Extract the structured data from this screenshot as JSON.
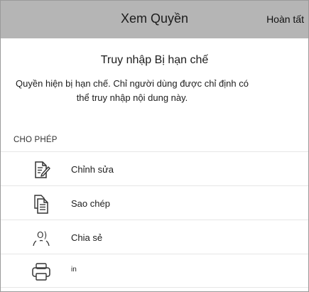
{
  "header": {
    "title": "Xem Quyền",
    "done_label": "Hoàn tất"
  },
  "main": {
    "section_title": "Truy nhập Bị hạn chế",
    "description": "Quyền hiện bị hạn chế. Chỉ người dùng được chỉ định có thể truy nhập nội dung này.",
    "group_label": "CHO PHÉP",
    "permissions": [
      {
        "label": "Chỉnh sửa",
        "icon": "edit-document-icon"
      },
      {
        "label": "Sao chép",
        "icon": "copy-document-icon"
      },
      {
        "label": "Chia sẻ",
        "icon": "share-people-icon"
      },
      {
        "label": "in",
        "icon": "printer-icon"
      }
    ]
  },
  "colors": {
    "header_bg": "#b5b5b5",
    "divider": "#e6e6e6",
    "text": "#1c1c1c"
  }
}
